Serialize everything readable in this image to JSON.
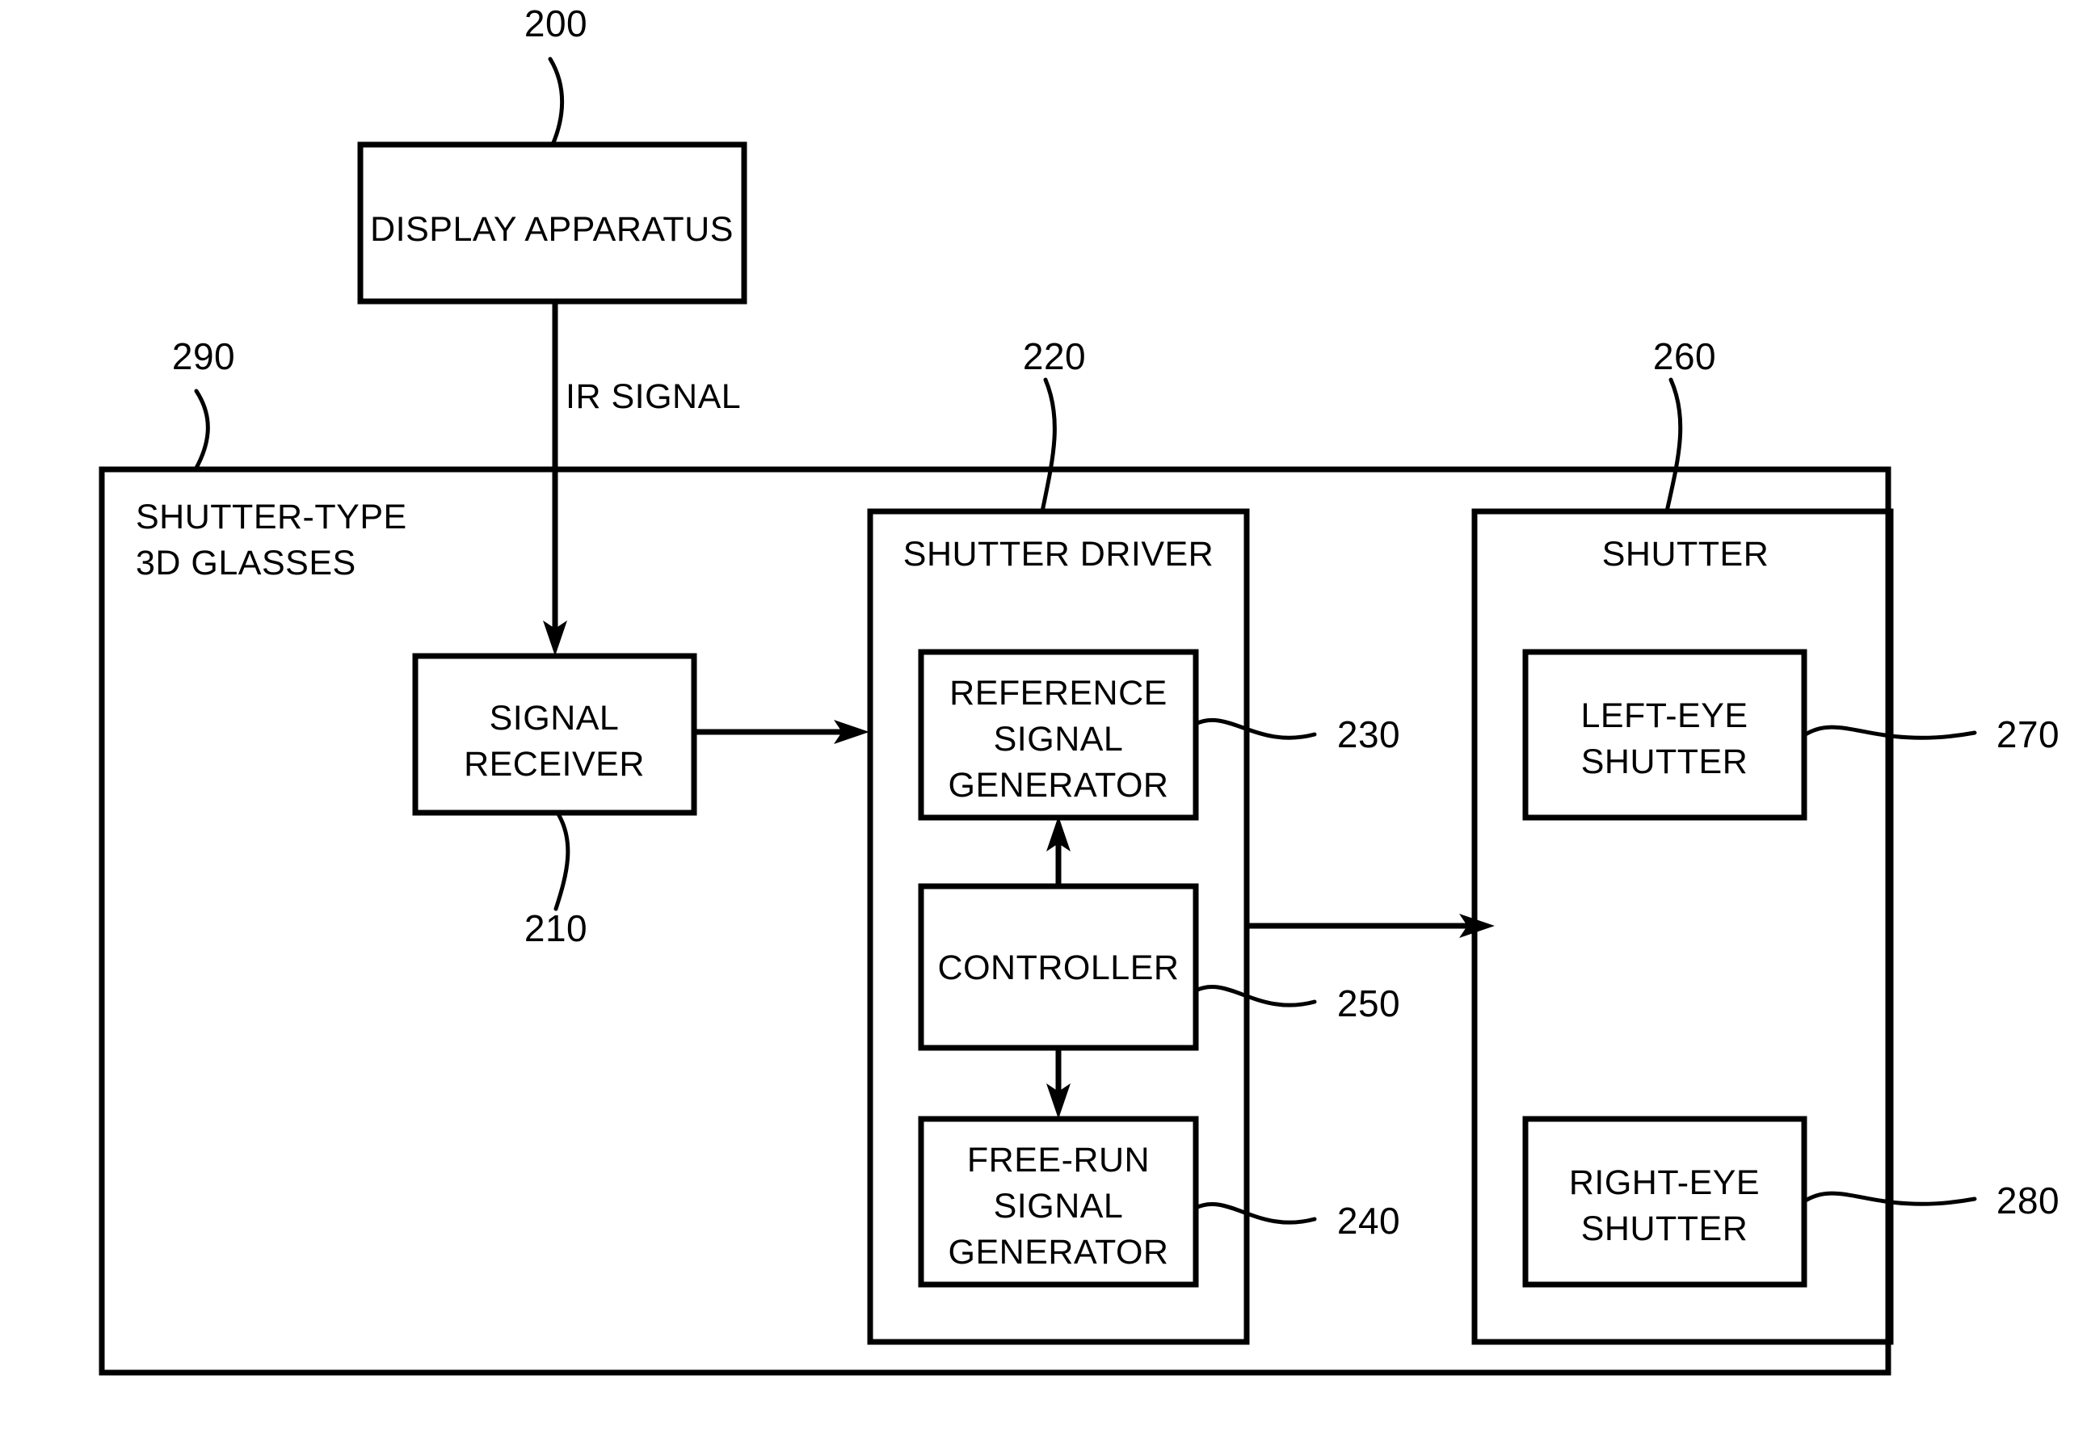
{
  "figure": {
    "type": "patent-block-diagram",
    "title": "Shutter-type 3D glasses system block diagram"
  },
  "blocks": {
    "display_apparatus": {
      "label": "DISPLAY APPARATUS",
      "ref": "200"
    },
    "glasses": {
      "label_line1": "SHUTTER-TYPE",
      "label_line2": "3D GLASSES",
      "ref": "290"
    },
    "signal_receiver": {
      "label_line1": "SIGNAL",
      "label_line2": "RECEIVER",
      "ref": "210"
    },
    "shutter_driver": {
      "label": "SHUTTER DRIVER",
      "ref": "220"
    },
    "reference_signal_generator": {
      "label_line1": "REFERENCE",
      "label_line2": "SIGNAL",
      "label_line3": "GENERATOR",
      "ref": "230"
    },
    "controller": {
      "label": "CONTROLLER",
      "ref": "250"
    },
    "free_run_signal_generator": {
      "label_line1": "FREE-RUN",
      "label_line2": "SIGNAL",
      "label_line3": "GENERATOR",
      "ref": "240"
    },
    "shutter": {
      "label": "SHUTTER",
      "ref": "260"
    },
    "left_eye_shutter": {
      "label_line1": "LEFT-EYE",
      "label_line2": "SHUTTER",
      "ref": "270"
    },
    "right_eye_shutter": {
      "label_line1": "RIGHT-EYE",
      "label_line2": "SHUTTER",
      "ref": "280"
    }
  },
  "connections": {
    "ir_signal": {
      "label": "IR SIGNAL"
    }
  },
  "colors": {
    "stroke": "#000000",
    "background": "#ffffff"
  }
}
